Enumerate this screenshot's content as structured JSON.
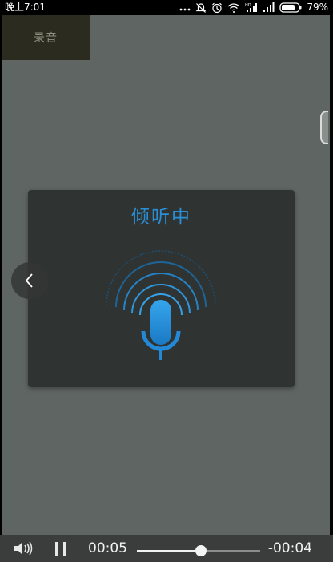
{
  "status_bar": {
    "time": "晚上7:01",
    "battery_percent": "79%",
    "icons": [
      "more-dots-icon",
      "mute-bell-icon",
      "alarm-icon",
      "wifi-icon",
      "hd-signal-icon",
      "signal-icon",
      "battery-icon"
    ]
  },
  "app": {
    "record_button_label": "录音",
    "background_color": "#5f6562"
  },
  "dialog": {
    "title": "倾听中",
    "title_color": "#2a8fd7",
    "icon": "microphone-icon"
  },
  "media_bar": {
    "elapsed": "00:05",
    "remaining": "-00:04",
    "progress_fraction": 0.52,
    "volume_icon": "volume-icon",
    "pause_icon": "pause-icon"
  }
}
